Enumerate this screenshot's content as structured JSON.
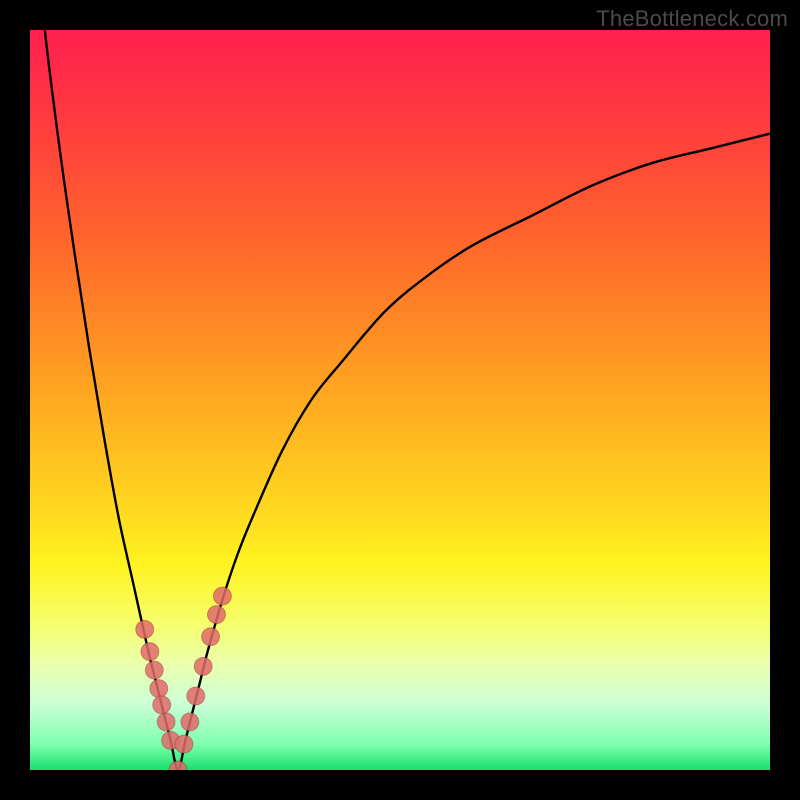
{
  "watermark": "TheBottleneck.com",
  "colors": {
    "gradient_stops": [
      {
        "offset": 0.0,
        "color": "#ff1f4f"
      },
      {
        "offset": 0.12,
        "color": "#ff3a3f"
      },
      {
        "offset": 0.3,
        "color": "#ff6a2a"
      },
      {
        "offset": 0.48,
        "color": "#ffa321"
      },
      {
        "offset": 0.63,
        "color": "#ffd21f"
      },
      {
        "offset": 0.72,
        "color": "#fff21f"
      },
      {
        "offset": 0.8,
        "color": "#f6ff6a"
      },
      {
        "offset": 0.86,
        "color": "#eaffb0"
      },
      {
        "offset": 0.91,
        "color": "#ccffd6"
      },
      {
        "offset": 0.965,
        "color": "#7fffb0"
      },
      {
        "offset": 1.0,
        "color": "#18e06a"
      }
    ],
    "curve": "#000000",
    "marker_fill": "#e06a6a",
    "marker_stroke": "#7a1f1f"
  },
  "chart_data": {
    "type": "line",
    "title": "",
    "xlabel": "",
    "ylabel": "",
    "xlim": [
      0,
      100
    ],
    "ylim": [
      0,
      100
    ],
    "x_optimum": 20,
    "series": [
      {
        "name": "bottleneck-curve",
        "x": [
          0,
          2,
          4,
          6,
          8,
          10,
          12,
          14,
          16,
          17,
          18,
          19,
          20,
          21,
          22,
          23,
          24,
          26,
          28,
          30,
          34,
          38,
          42,
          48,
          54,
          60,
          68,
          76,
          84,
          92,
          100
        ],
        "values": [
          120,
          100,
          84,
          70,
          57,
          45,
          34,
          25,
          16,
          12,
          8,
          4,
          0,
          4,
          8,
          12,
          16,
          23,
          29,
          34,
          43,
          50,
          55,
          62,
          67,
          71,
          75,
          79,
          82,
          84,
          86
        ]
      }
    ],
    "markers": {
      "name": "highlighted-points",
      "x": [
        15.5,
        16.2,
        16.8,
        17.4,
        17.8,
        18.4,
        19.0,
        20.0,
        20.8,
        21.6,
        22.4,
        23.4,
        24.4,
        25.2,
        26.0
      ],
      "values": [
        19.0,
        16.0,
        13.5,
        11.0,
        8.8,
        6.5,
        4.0,
        0.0,
        3.5,
        6.5,
        10.0,
        14.0,
        18.0,
        21.0,
        23.5
      ]
    }
  }
}
